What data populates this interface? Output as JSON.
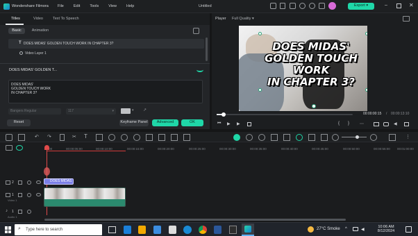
{
  "app": {
    "name": "Wondershare Filmora",
    "title": "Untitled",
    "menu": [
      "File",
      "Edit",
      "Tools",
      "View",
      "Help"
    ],
    "export_label": "Export"
  },
  "left_panel": {
    "tabs": [
      "Titles",
      "Video",
      "Text To Speech"
    ],
    "subtabs": [
      "Basic",
      "Animation"
    ],
    "layers": [
      "DOES MIDAS' GOLDEN TOUCH WORK IN CHAPTER 3?",
      "Video Layer 1"
    ],
    "section_title": "DOES MIDAS' GOLDEN T...",
    "text_lines": [
      "DOES MIDAS'",
      "GOLDEN TOUCH WORK",
      "IN CHAPTER 3?"
    ],
    "font_value": "Bangers Regular",
    "size_value": "117",
    "buttons": {
      "reset": "Reset",
      "keyframe": "Keyframe Panel",
      "advanced": "Advanced",
      "ok": "OK"
    }
  },
  "player": {
    "label": "Player",
    "quality": "Full Quality",
    "overlay_lines": [
      "DOES MIDAS'",
      "GOLDEN TOUCH WORK",
      "IN CHAPTER 3?"
    ],
    "current_time": "00:00:00:15",
    "total_time": "00:00:13:10",
    "progress": 0.05
  },
  "timeline": {
    "ticks": [
      "00:00",
      "00:00:05:00",
      "00:00:10:00",
      "00:00:15:00",
      "00:00:20:00",
      "00:00:25:00",
      "00:00:30:00",
      "00:00:35:00",
      "00:00:40:00",
      "00:00:45:00",
      "00:00:50:00",
      "00:00:55:00",
      "00:01:00:00"
    ],
    "tracks": [
      {
        "num": "2",
        "label": ""
      },
      {
        "num": "1",
        "label": "Video 1"
      },
      {
        "num": "1",
        "label": "Audio 1"
      }
    ],
    "title_clip": "DOES MIDAS"
  },
  "taskbar": {
    "search_placeholder": "Type here to search",
    "weather": "27°C  Smoke",
    "time": "10:06 AM",
    "date": "8/12/2024"
  },
  "colors": {
    "accent": "#1fd7a8",
    "panel": "#232528",
    "bg": "#151617",
    "clip_title": "#7b7fe6",
    "clip_audio": "#2b8a6e"
  }
}
